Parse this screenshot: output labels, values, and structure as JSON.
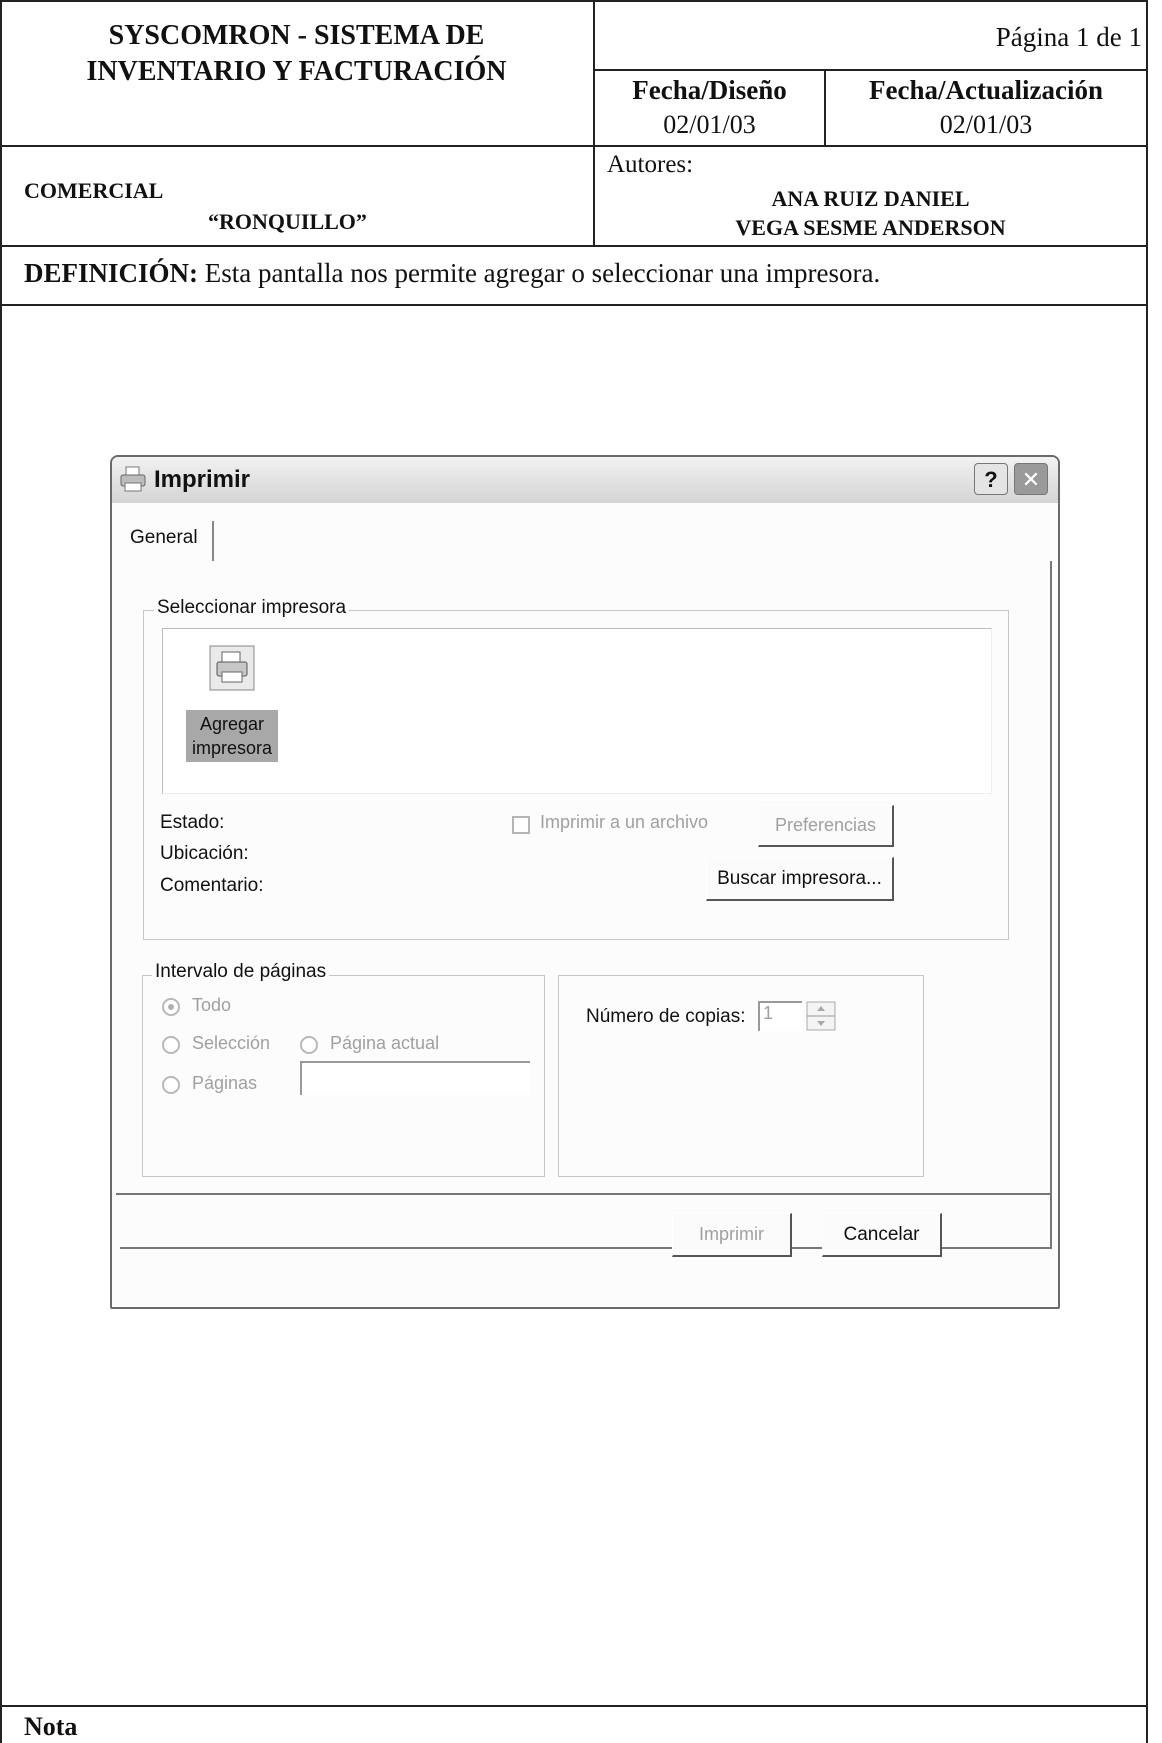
{
  "header": {
    "system_title": "SYSCOMRON - SISTEMA DE INVENTARIO Y FACTURACIÓN",
    "page": "Página 1 de 1",
    "design_date_label": "Fecha/Diseño",
    "design_date": "02/01/03",
    "update_date_label": "Fecha/Actualización",
    "update_date": "02/01/03",
    "company_line1": "COMERCIAL",
    "company_line2": "“RONQUILLO”",
    "authors_label": "Autores:",
    "author1": "ANA RUIZ DANIEL",
    "author2": "VEGA SESME ANDERSON"
  },
  "definition": {
    "label": "DEFINICIÓN:",
    "text": " Esta pantalla nos permite agregar o seleccionar una impresora."
  },
  "dialog": {
    "title": "Imprimir",
    "help_button": "?",
    "close_button": "✕",
    "tab": "General",
    "select_printer_group": "Seleccionar impresora",
    "add_printer_line1": "Agregar",
    "add_printer_line2": "impresora",
    "status_label": "Estado:",
    "location_label": "Ubicación:",
    "comment_label": "Comentario:",
    "print_to_file": "Imprimir a un archivo",
    "preferences_button": "Preferencias",
    "find_printer_button": "Buscar impresora...",
    "page_range_group": "Intervalo de páginas",
    "range_all": "Todo",
    "range_selection": "Selección",
    "range_current_page": "Página actual",
    "range_pages": "Páginas",
    "copies_label": "Número de copias:",
    "copies_value": "1",
    "print_button": "Imprimir",
    "cancel_button": "Cancelar"
  },
  "footer": {
    "note_label": "Nota"
  }
}
